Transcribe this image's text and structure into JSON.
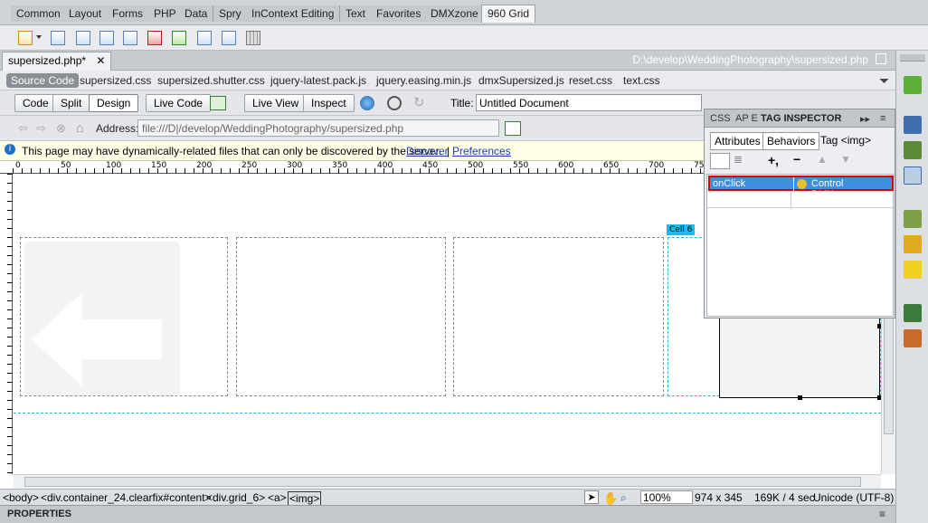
{
  "insert_tabs": [
    "Common",
    "Layout",
    "Forms",
    "PHP",
    "Data",
    "Spry",
    "InContext Editing",
    "Text",
    "Favorites",
    "DMXzone",
    "960 Grid"
  ],
  "document": {
    "tab_label": "supersized.php*",
    "path": "D:\\develop\\WeddingPhotography\\supersized.php"
  },
  "related_files": [
    "Source Code",
    "supersized.css",
    "supersized.shutter.css",
    "jquery-latest.pack.js",
    "jquery.easing.min.js",
    "dmxSupersized.js",
    "reset.css",
    "text.css"
  ],
  "toolbar": {
    "code_label": "Code",
    "split_label": "Split",
    "design_label": "Design",
    "live_code_label": "Live Code",
    "live_view_label": "Live View",
    "inspect_label": "Inspect",
    "title_label": "Title:",
    "title_value": "Untitled Document"
  },
  "nav": {
    "address_label": "Address:",
    "address_value": "file:///D|/develop/WeddingPhotography/supersized.php"
  },
  "info_bar": {
    "message": "This page may have dynamically-related files that can only be discovered by the server.",
    "discover_link": "Discover",
    "separator": "|",
    "preferences_link": "Preferences"
  },
  "ruler_ticks": [
    "0",
    "50",
    "100",
    "150",
    "200",
    "250",
    "300",
    "350",
    "400",
    "450",
    "500",
    "550",
    "600",
    "650",
    "700",
    "75"
  ],
  "canvas": {
    "cell_label": "Cell 6"
  },
  "tag_inspector": {
    "tab_css": "CSS",
    "tab_ap": "AP E",
    "tab_tag": "TAG INSPECTOR",
    "attributes_tab": "Attributes",
    "behaviors_tab": "Behaviors",
    "tag_label": "Tag <img>",
    "add_label": "+,",
    "remove_label": "−",
    "event": "onClick",
    "action": "Control DMXzon..."
  },
  "status_bar": {
    "tag_path": [
      "<body>",
      "<div.container_24.clearfix#content>",
      "<div.grid_6>",
      "<a>",
      "<img>"
    ],
    "zoom": "100%",
    "dimensions": "974 x 345",
    "size_time": "169K / 4 sec",
    "encoding": "Unicode (UTF-8)"
  },
  "properties": {
    "label": "PROPERTIES"
  },
  "colors": {
    "selection_blue": "#3f8fe0",
    "cell_tag_cyan": "#22b9e6",
    "highlight_red": "#dd0000"
  }
}
